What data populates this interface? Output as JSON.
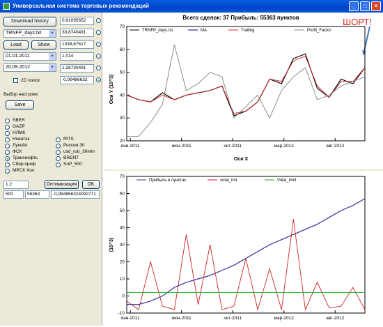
{
  "window": {
    "title": "Универсальная система торговых рекомендаций"
  },
  "controls": {
    "download_history": "Download history",
    "file": "TRNFP_days.txt",
    "load": "Load",
    "show": "Show",
    "date_from": "01.01.2011",
    "date_to": "20.09.2012",
    "search2d": "2D поиск:",
    "settings_label": "Выбор настроек:",
    "save": "Save",
    "params": [
      "0,91095652",
      "30,8740491",
      "1038,67617",
      "1,014",
      "1,28730491",
      "-0,99486632"
    ],
    "selected_param": 5,
    "instruments_col1": [
      "SBER",
      "GAZP",
      "НЛМК",
      "Новатэк",
      "Лукойл",
      "ФСК",
      "Транснефть",
      "Сбер.преф",
      "МРСК Хол"
    ],
    "instruments_col2": [
      "fRTS",
      "Россия 30",
      "usd_rub_30min",
      "BRENT",
      "SnP_500"
    ],
    "selected_instrument": "Транснефть",
    "opt_value": "1.2",
    "optimize": "Оптимизация",
    "ok": "OK",
    "bottom_values": [
      "500",
      "55363",
      "-0,994866324092771"
    ]
  },
  "chart_top": {
    "title": "Всего сделок:  37 Прибыль: 55363 пунктов",
    "annotation": "ШОРТ!",
    "xlabel": "Оси X",
    "ylabel": "Оси Y (10^3)",
    "legend": [
      "TRNFP_days.txt",
      "MA",
      "Trailing",
      "Profit_Factor"
    ],
    "xticks": [
      "янв-2011",
      "июн-2011",
      "окт-2011",
      "мар-2012",
      "авг-2012"
    ],
    "yticks": [
      "20",
      "30",
      "40",
      "50",
      "60",
      "70"
    ]
  },
  "chart_bottom": {
    "ylabel": "(10^3)",
    "legend": [
      "Прибыль в пунктах",
      "volat_ind",
      "Volat_limit"
    ],
    "xticks": [
      "янв-2011",
      "июн-2011",
      "окт-2011",
      "мар-2012",
      "авг-2012"
    ],
    "yticks": [
      "-10",
      "0",
      "10",
      "20",
      "30",
      "40",
      "50",
      "60",
      "70"
    ]
  },
  "colors": {
    "price": "#000000",
    "ma": "#0000aa",
    "trailing": "#dd2222",
    "profit_factor": "#808080",
    "profit": "#3030a0",
    "volat": "#cc2222",
    "volat_limit": "#22aa22",
    "titlebar": "#0045c8"
  },
  "chart_data": [
    {
      "type": "line",
      "title": "Всего сделок:  37 Прибыль: 55363 пунктов",
      "xlabel": "Оси X",
      "ylabel": "Оси Y (10^3)",
      "ylim": [
        20,
        70
      ],
      "x_range": [
        "янв-2011",
        "сен-2012"
      ],
      "legend_position": "top",
      "series": [
        {
          "name": "TRNFP_days.txt",
          "x": [
            0,
            1,
            2,
            3,
            4,
            5,
            6,
            7,
            8,
            9,
            10,
            11,
            12,
            13,
            14,
            15,
            16,
            17,
            18,
            19,
            20
          ],
          "values": [
            40,
            38,
            37,
            41,
            38,
            40,
            41,
            42,
            44,
            31,
            33,
            37,
            47,
            45,
            56,
            58,
            43,
            39,
            47,
            45,
            52
          ]
        },
        {
          "name": "Trailing",
          "x": [
            0,
            1,
            2,
            3,
            4,
            5,
            6,
            7,
            8,
            9,
            10,
            11,
            12,
            13,
            14,
            15,
            16,
            17,
            18,
            19,
            20
          ],
          "values": [
            40,
            38,
            37,
            40,
            38,
            40,
            41,
            42,
            44,
            32,
            33,
            37,
            47,
            46,
            55,
            57,
            44,
            39,
            46,
            46,
            52
          ]
        },
        {
          "name": "Profit_Factor",
          "x": [
            0,
            1,
            2,
            3,
            4,
            5,
            6,
            7,
            8,
            9,
            10,
            11,
            12,
            13,
            14,
            15,
            16,
            17,
            18,
            19,
            20
          ],
          "values": [
            22,
            22,
            28,
            36,
            62,
            42,
            45,
            50,
            48,
            30,
            35,
            40,
            30,
            42,
            48,
            52,
            38,
            40,
            44,
            46,
            48
          ]
        }
      ]
    },
    {
      "type": "line",
      "ylabel": "(10^3)",
      "ylim": [
        -10,
        70
      ],
      "x_range": [
        "янв-2011",
        "сен-2012"
      ],
      "legend_position": "top",
      "series": [
        {
          "name": "Прибыль в пунктах",
          "x": [
            0,
            1,
            2,
            3,
            4,
            5,
            6,
            7,
            8,
            9,
            10,
            11,
            12,
            13,
            14,
            15,
            16,
            17,
            18,
            19,
            20
          ],
          "values": [
            -5,
            -5,
            -3,
            0,
            5,
            8,
            10,
            12,
            15,
            18,
            22,
            26,
            30,
            33,
            36,
            39,
            42,
            46,
            50,
            53,
            57
          ]
        },
        {
          "name": "volat_ind",
          "x": [
            0,
            1,
            2,
            3,
            4,
            5,
            6,
            7,
            8,
            9,
            10,
            11,
            12,
            13,
            14,
            15,
            16,
            17,
            18,
            19,
            20
          ],
          "values": [
            -3,
            -8,
            20,
            -6,
            -8,
            36,
            -5,
            30,
            -8,
            -6,
            22,
            -8,
            16,
            -8,
            45,
            -8,
            8,
            -7,
            -6,
            5,
            -8
          ]
        },
        {
          "name": "Volat_limit",
          "x": [
            0,
            20
          ],
          "values": [
            2,
            2
          ]
        }
      ]
    }
  ]
}
